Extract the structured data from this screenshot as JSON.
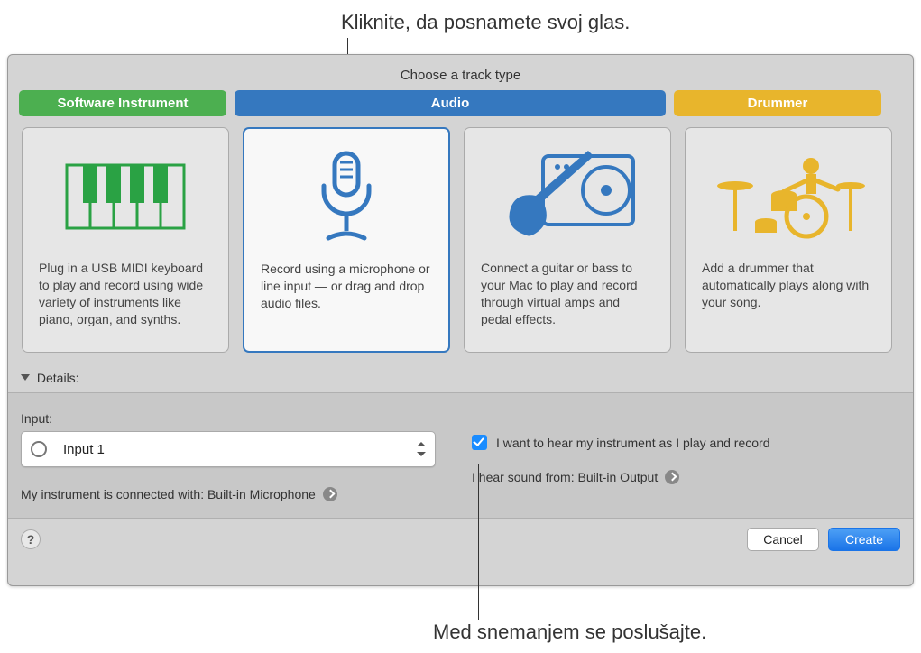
{
  "callouts": {
    "top": "Kliknite, da posnamete svoj glas.",
    "bottom": "Med snemanjem se poslušajte."
  },
  "panel": {
    "title": "Choose a track type",
    "tabs": {
      "software_instrument": "Software Instrument",
      "audio": "Audio",
      "drummer": "Drummer"
    },
    "cards": {
      "software_instrument": {
        "desc": "Plug in a USB MIDI keyboard to play and record using wide variety of instruments like piano, organ, and synths."
      },
      "audio_mic": {
        "desc": "Record using a microphone or line input — or drag and drop audio files.",
        "selected": true
      },
      "audio_guitar": {
        "desc": "Connect a guitar or bass to your Mac to play and record through virtual amps and pedal effects."
      },
      "drummer": {
        "desc": "Add a drummer that automatically plays along with your song."
      }
    },
    "details": {
      "label": "Details:",
      "input_label": "Input:",
      "input_value": "Input 1",
      "connected_text": "My instrument is connected with: Built-in Microphone",
      "monitor_label": "I want to hear my instrument as I play and record",
      "monitor_checked": true,
      "output_text": "I hear sound from: Built-in Output"
    },
    "footer": {
      "help": "?",
      "cancel": "Cancel",
      "create": "Create"
    }
  }
}
